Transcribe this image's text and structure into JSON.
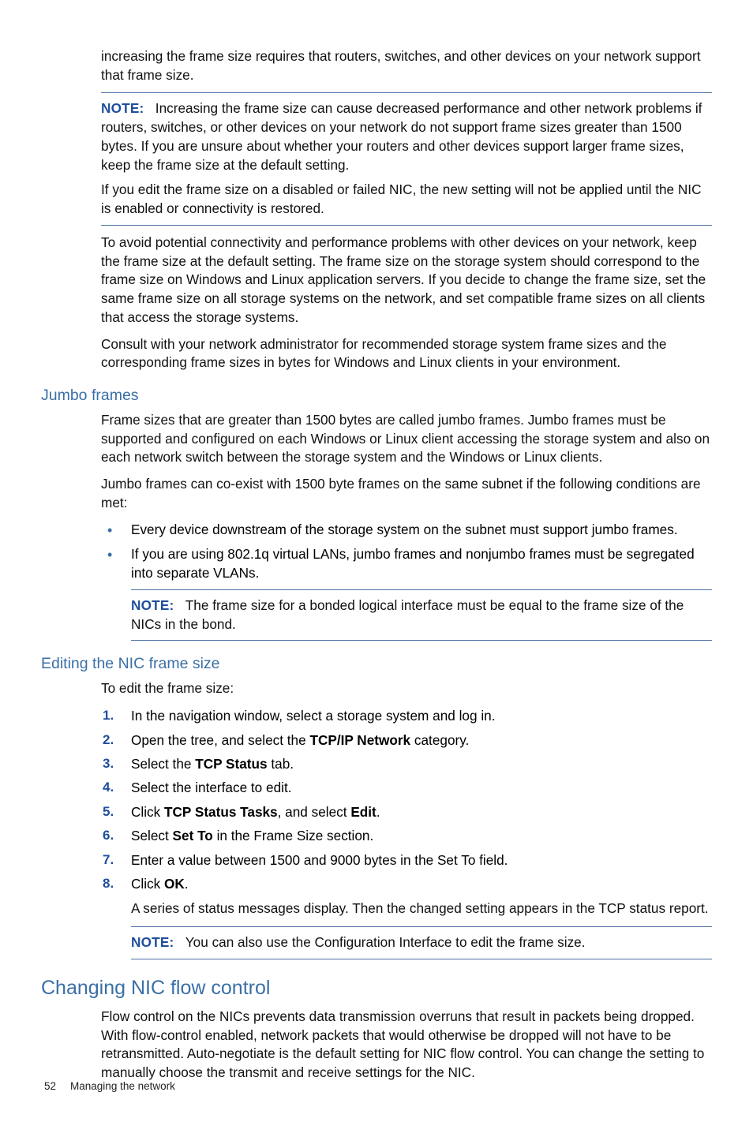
{
  "intro_p1": "increasing the frame size requires that routers, switches, and other devices on your network support that frame size.",
  "note1": {
    "label": "NOTE:",
    "p1": "Increasing the frame size can cause decreased performance and other network problems if routers, switches, or other devices on your network do not support frame sizes greater than 1500 bytes. If you are unsure about whether your routers and other devices support larger frame sizes, keep the frame size at the default setting.",
    "p2": "If you edit the frame size on a disabled or failed NIC, the new setting will not be applied until the NIC is enabled or connectivity is restored."
  },
  "p2": "To avoid potential connectivity and performance problems with other devices on your network, keep the frame size at the default setting. The frame size on the storage system should correspond to the frame size on Windows and Linux application servers. If you decide to change the frame size, set the same frame size on all storage systems on the network, and set compatible frame sizes on all clients that access the storage systems.",
  "p3": "Consult with your network administrator for recommended storage system frame sizes and the corresponding frame sizes in bytes for Windows and Linux clients in your environment.",
  "jumbo": {
    "heading": "Jumbo frames",
    "p1": "Frame sizes that are greater than 1500 bytes are called jumbo frames. Jumbo frames must be supported and configured on each Windows or Linux client accessing the storage system and also on each network switch between the storage system and the Windows or Linux clients.",
    "p2": "Jumbo frames can co-exist with 1500 byte frames on the same subnet if the following conditions are met:",
    "b1": "Every device downstream of the storage system on the subnet must support jumbo frames.",
    "b2": "If you are using 802.1q virtual LANs, jumbo frames and nonjumbo frames must be segregated into separate VLANs.",
    "note": {
      "label": "NOTE:",
      "text": "The frame size for a bonded logical interface must be equal to the frame size of the NICs in the bond."
    }
  },
  "edit": {
    "heading": "Editing the NIC frame size",
    "lead": "To edit the frame size:",
    "s1": "In the navigation window, select a storage system and log in.",
    "s2a": "Open the tree, and select the ",
    "s2b": "TCP/IP Network",
    "s2c": " category.",
    "s3a": "Select the ",
    "s3b": "TCP Status",
    "s3c": " tab.",
    "s4": "Select the interface to edit.",
    "s5a": "Click ",
    "s5b": "TCP Status Tasks",
    "s5c": ", and select ",
    "s5d": "Edit",
    "s5e": ".",
    "s6a": "Select ",
    "s6b": "Set To",
    "s6c": " in the Frame Size section.",
    "s7": "Enter a value between 1500 and 9000 bytes in the Set To field.",
    "s8a": "Click ",
    "s8b": "OK",
    "s8c": ".",
    "after": "A series of status messages display. Then the changed setting appears in the TCP status report.",
    "note": {
      "label": "NOTE:",
      "text": "You can also use the Configuration Interface to edit the frame size."
    }
  },
  "flow": {
    "heading": "Changing NIC flow control",
    "p1": "Flow control on the NICs prevents data transmission overruns that result in packets being dropped. With flow-control enabled, network packets that would otherwise be dropped will not have to be retransmitted. Auto-negotiate is the default setting for NIC flow control. You can change the setting to manually choose the transmit and receive settings for the NIC."
  },
  "footer": {
    "page": "52",
    "title": "Managing the network"
  }
}
